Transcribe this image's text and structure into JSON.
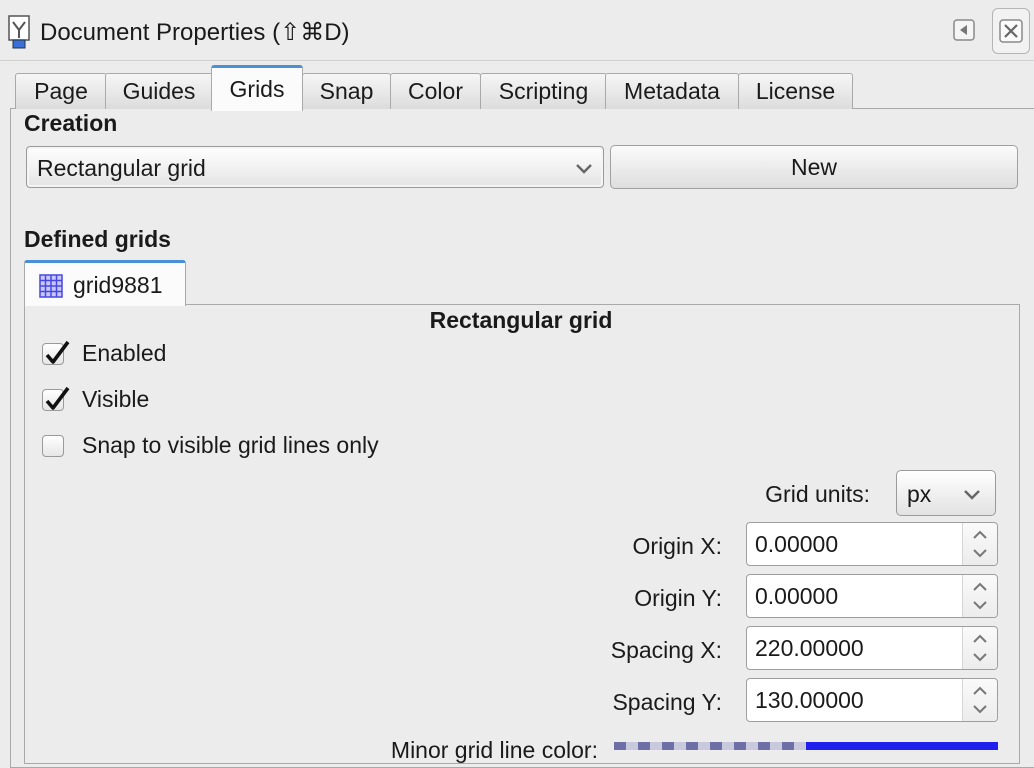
{
  "window": {
    "title": "Document Properties (⇧⌘D)",
    "icons": {
      "app": "document-properties-icon",
      "dock": "dock-left-icon",
      "close": "close-icon"
    }
  },
  "tabs": [
    {
      "label": "Page",
      "active": false
    },
    {
      "label": "Guides",
      "active": false
    },
    {
      "label": "Grids",
      "active": true
    },
    {
      "label": "Snap",
      "active": false
    },
    {
      "label": "Color",
      "active": false
    },
    {
      "label": "Scripting",
      "active": false
    },
    {
      "label": "Metadata",
      "active": false
    },
    {
      "label": "License",
      "active": false
    }
  ],
  "creation": {
    "heading": "Creation",
    "grid_type": "Rectangular grid",
    "new_label": "New"
  },
  "defined": {
    "heading": "Defined grids",
    "grid_tab_label": "grid9881",
    "grid_heading": "Rectangular grid",
    "enabled_label": "Enabled",
    "enabled_checked": true,
    "visible_label": "Visible",
    "visible_checked": true,
    "snap_label": "Snap to visible grid lines only",
    "snap_checked": false,
    "units_label": "Grid units:",
    "units_value": "px",
    "origin_x_label": "Origin X:",
    "origin_x": "0.00000",
    "origin_y_label": "Origin Y:",
    "origin_y": "0.00000",
    "spacing_x_label": "Spacing X:",
    "spacing_x": "220.00000",
    "spacing_y_label": "Spacing Y:",
    "spacing_y": "130.00000",
    "minor_color_label": "Minor grid line color:",
    "minor_color": "#2020ee"
  }
}
